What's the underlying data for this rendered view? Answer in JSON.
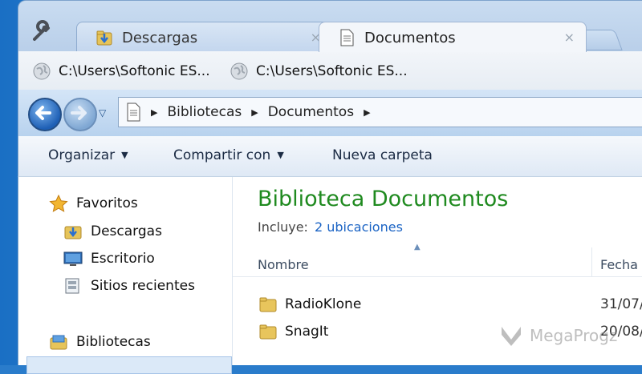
{
  "tabs": [
    {
      "label": "Descargas",
      "icon": "downloads-folder-icon",
      "active": false
    },
    {
      "label": "Documentos",
      "icon": "document-icon",
      "active": true
    }
  ],
  "tab_close": "×",
  "bookmarks": [
    {
      "label": "C:\\Users\\Softonic ES...",
      "icon": "globe-icon"
    },
    {
      "label": "C:\\Users\\Softonic ES...",
      "icon": "globe-icon"
    }
  ],
  "address": {
    "crumbs": [
      "Bibliotecas",
      "Documentos"
    ]
  },
  "commands": {
    "organize": "Organizar",
    "share": "Compartir con",
    "new_folder": "Nueva carpeta"
  },
  "navpane": {
    "favorites": "Favoritos",
    "downloads": "Descargas",
    "desktop": "Escritorio",
    "recent": "Sitios recientes",
    "libraries": "Bibliotecas"
  },
  "content": {
    "title": "Biblioteca Documentos",
    "includes_label": "Incluye:",
    "includes_link": "2 ubicaciones",
    "columns": {
      "name": "Nombre",
      "date": "Fecha"
    },
    "rows": [
      {
        "name": "RadioKlone",
        "date": "31/07/"
      },
      {
        "name": "SnagIt",
        "date": "20/08/"
      }
    ]
  },
  "watermark": "MegaProgz",
  "colors": {
    "library_title": "#1f8a1f",
    "link": "#1a63c4",
    "accent": "#2a7ccb"
  }
}
